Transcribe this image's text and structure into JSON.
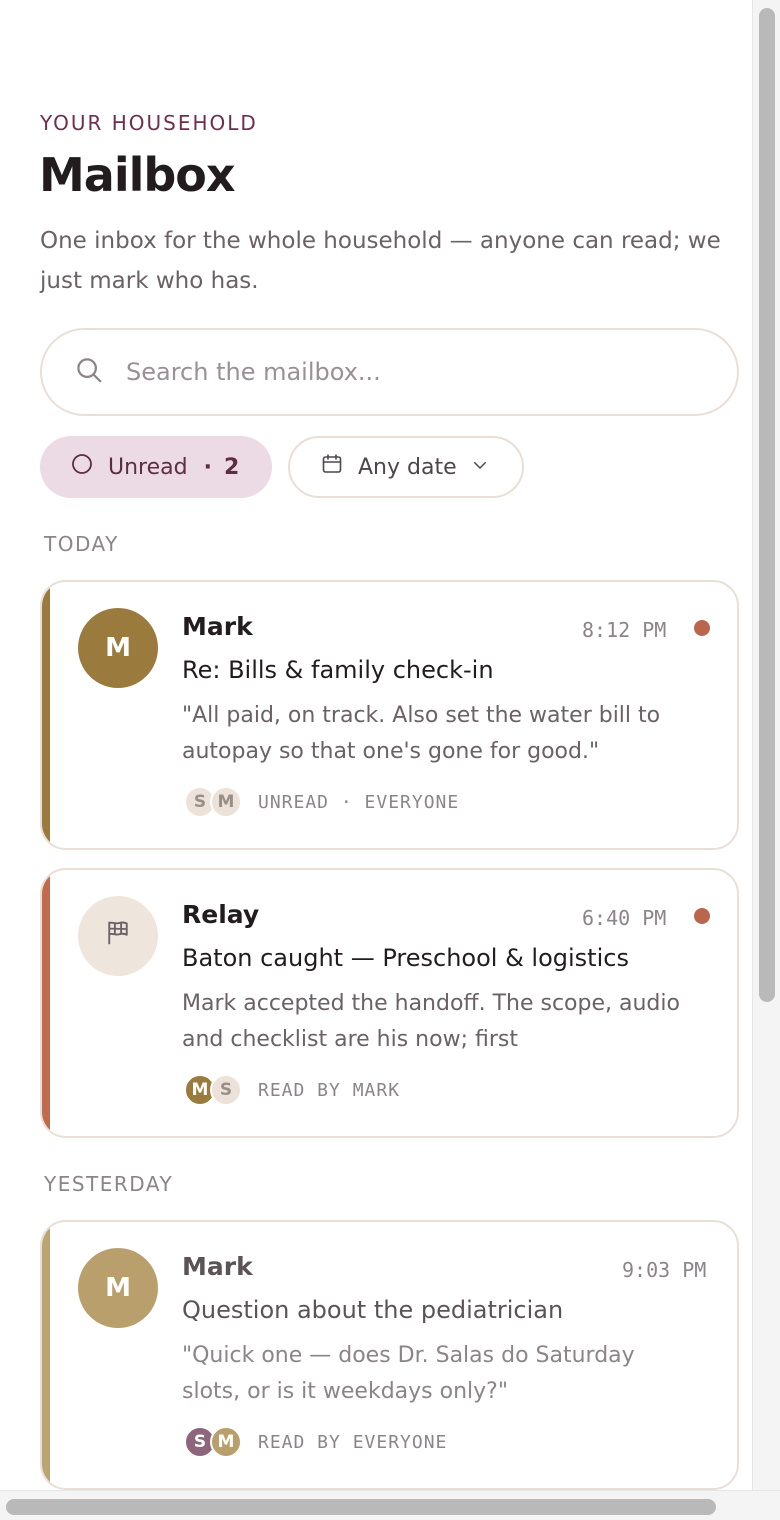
{
  "header": {
    "eyebrow": "YOUR HOUSEHOLD",
    "title": "Mailbox",
    "subtitle": "One inbox for the whole household — anyone can read; we just mark who has."
  },
  "search": {
    "placeholder": "Search the mailbox..."
  },
  "filters": {
    "unread": {
      "label": "Unread",
      "separator": "·",
      "count": "2"
    },
    "date": {
      "label": "Any date"
    }
  },
  "sections": {
    "today": "TODAY",
    "yesterday": "YESTERDAY"
  },
  "messages": [
    {
      "sender": "Mark",
      "avatar_letter": "M",
      "time": "8:12 PM",
      "subject": "Re: Bills & family check-in",
      "preview": "\"All paid, on track. Also set the water bill to autopay so that one's gone for good.\"",
      "readers": [
        "S",
        "M"
      ],
      "status": "UNREAD · EVERYONE",
      "unread": true,
      "accent": "#9b7b3d"
    },
    {
      "sender": "Relay",
      "avatar_icon": "flag-icon",
      "time": "6:40 PM",
      "subject": "Baton caught — Preschool & logistics",
      "preview": "Mark accepted the handoff. The scope, audio and checklist are his now; first",
      "readers": [
        "M",
        "S"
      ],
      "status": "READ BY MARK",
      "unread": true,
      "accent": "#c06a50"
    },
    {
      "sender": "Mark",
      "avatar_letter": "M",
      "time": "9:03 PM",
      "subject": "Question about the pediatrician",
      "preview": "\"Quick one — does Dr. Salas do Saturday slots, or is it weekdays only?\"",
      "readers": [
        "S",
        "M"
      ],
      "status": "READ BY EVERYONE",
      "unread": false,
      "accent": "#bba374"
    }
  ],
  "colors": {
    "accent_plum": "#6e2f4e",
    "unread_dot": "#b9664d",
    "chip_bg": "#ecdbe5"
  }
}
